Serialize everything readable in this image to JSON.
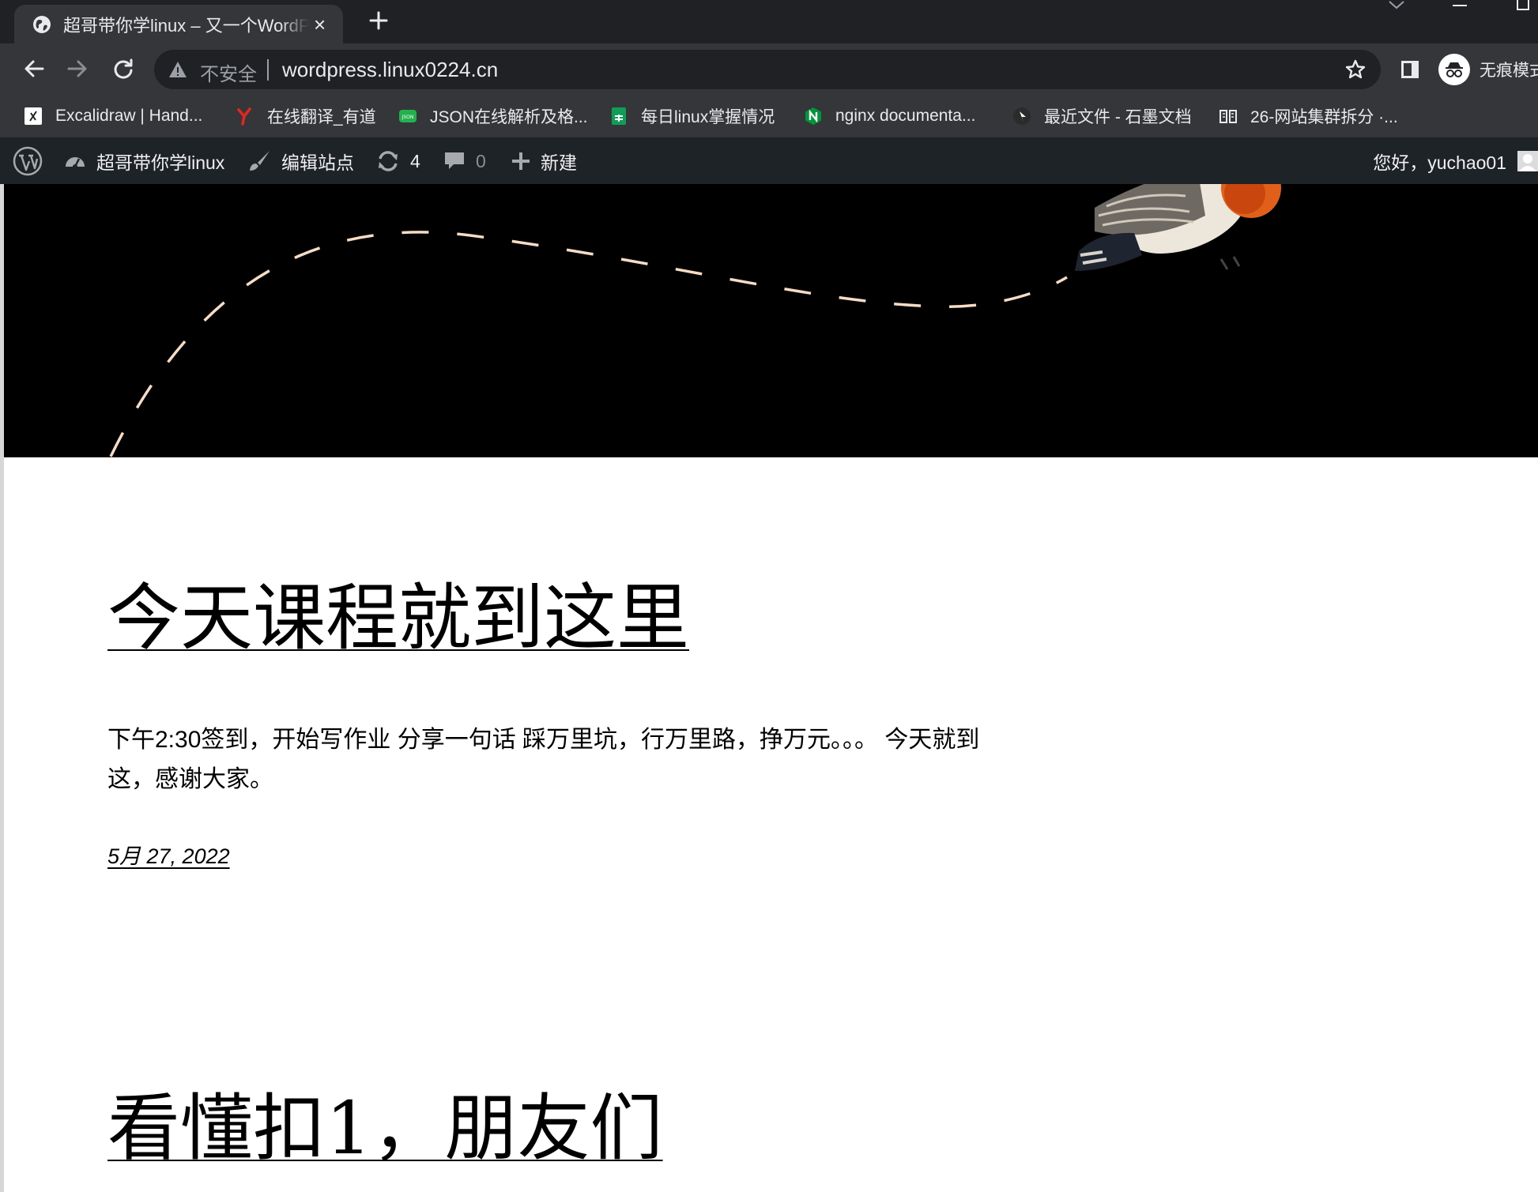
{
  "browser": {
    "tab": {
      "title": "超哥带你学linux – 又一个WordPress站点",
      "close_glyph": "×"
    },
    "new_tab_glyph": "+",
    "omnibox": {
      "security_label": "不安全",
      "url": "wordpress.linux0224.cn"
    },
    "profile_label": "无痕模式",
    "bookmarks": [
      {
        "label": "Excalidraw | Hand...",
        "icon": "excalidraw-icon"
      },
      {
        "label": "在线翻译_有道",
        "icon": "youdao-icon"
      },
      {
        "label": "JSON在线解析及格...",
        "icon": "json-icon"
      },
      {
        "label": "每日linux掌握情况",
        "icon": "sheets-icon"
      },
      {
        "label": "nginx documenta...",
        "icon": "nginx-icon"
      },
      {
        "label": "最近文件 - 石墨文档",
        "icon": "shimo-icon"
      },
      {
        "label": "26-网站集群拆分 ·...",
        "icon": "book-icon"
      }
    ]
  },
  "adminbar": {
    "site_name": "超哥带你学linux",
    "customize_label": "编辑站点",
    "updates_count": "4",
    "comments_count": "0",
    "new_label": "新建",
    "greeting": "您好，yuchao01"
  },
  "posts": [
    {
      "title": "今天课程就到这里",
      "excerpt": "下午2:30签到，开始写作业 分享一句话 踩万里坑，行万里路，挣万元。。。 今天就到这，感谢大家。",
      "date": "5月 27, 2022"
    },
    {
      "title": "看懂扣1，朋友们"
    }
  ],
  "colors": {
    "tabstrip": "#202124",
    "toolbar": "#35363a",
    "adminbar": "#1d2327",
    "hero": "#000000",
    "dash_line": "#f6dcc4",
    "bird_orange": "#e0601a"
  }
}
